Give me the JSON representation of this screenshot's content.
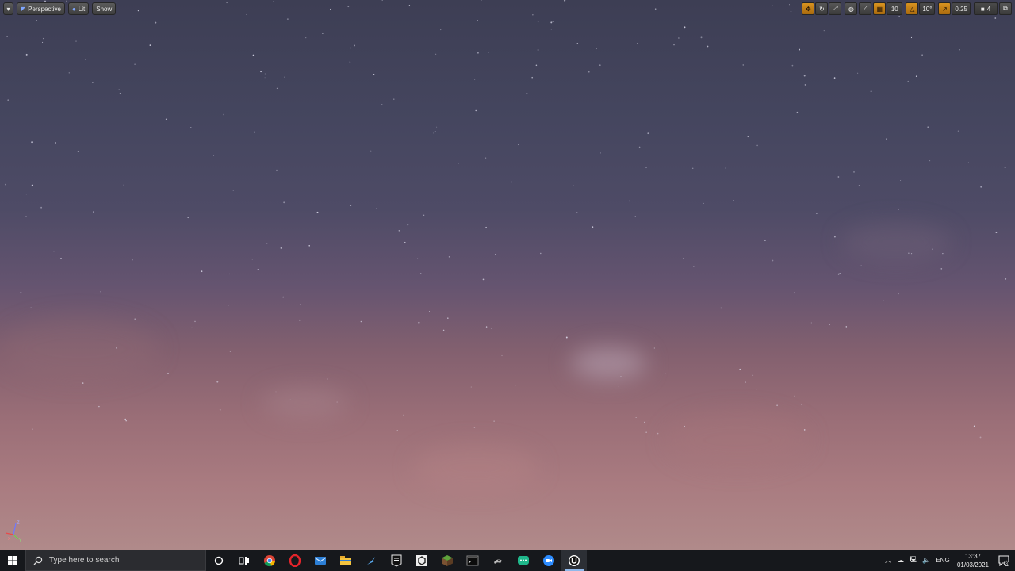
{
  "viewport": {
    "toolbar_left": {
      "dropdown_label": "▾",
      "perspective_label": "Perspective",
      "lit_label": "Lit",
      "show_label": "Show"
    },
    "toolbar_right": {
      "grid_snap_value": "10",
      "rotation_snap_value": "10°",
      "scale_snap_value": "0.25",
      "camera_speed_value": "4"
    },
    "axis_labels": {
      "z": "Z",
      "x": "X",
      "y": "Y"
    }
  },
  "taskbar": {
    "search_placeholder": "Type here to search",
    "apps": [
      "cortana",
      "task-view",
      "chrome",
      "opera",
      "mail",
      "file-explorer",
      "steam",
      "epic-games",
      "unity",
      "minecraft",
      "terminal",
      "mouse-app",
      "messaging-app",
      "zoom",
      "unreal-engine"
    ],
    "tray": {
      "language": "ENG",
      "time": "13:37",
      "date": "01/03/2021",
      "notification_count": "3"
    }
  },
  "colors": {
    "accent_orange": "#d8921f",
    "taskbar_bg": "#16181c",
    "sky_top": "#3d3e54",
    "sky_bottom": "#b08a8a"
  }
}
